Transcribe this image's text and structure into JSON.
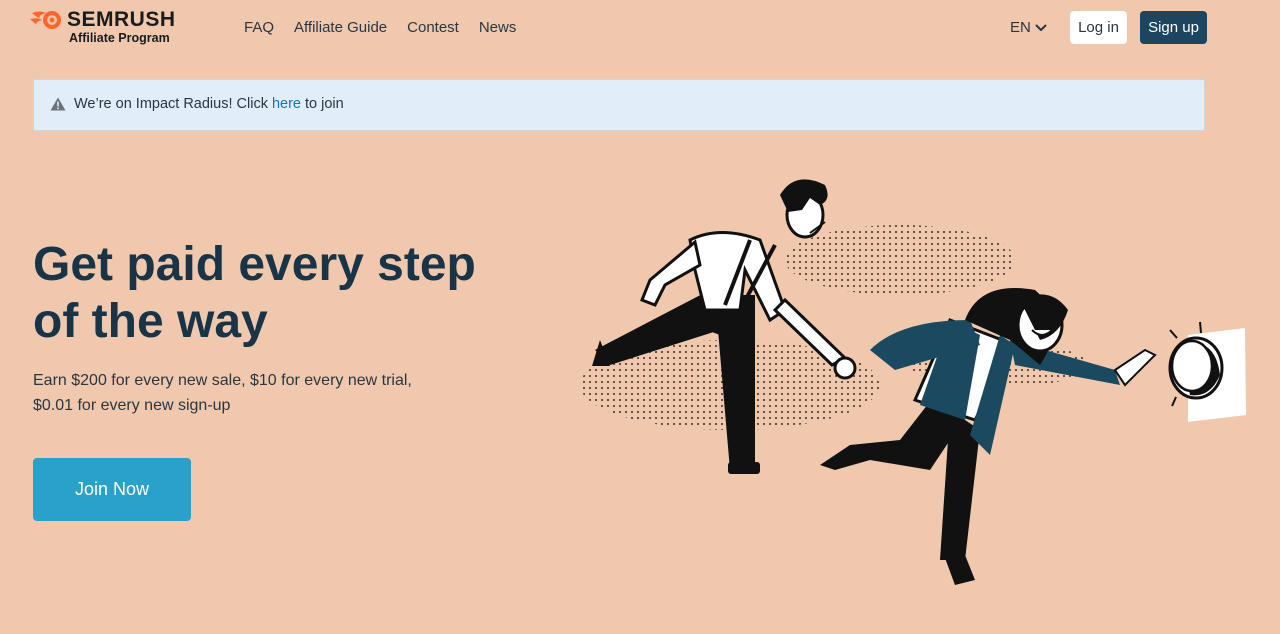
{
  "header": {
    "brand": "SEMRUSH",
    "brand_sub": "Affiliate Program",
    "nav": {
      "faq": "FAQ",
      "guide": "Affiliate Guide",
      "contest": "Contest",
      "news": "News"
    },
    "language": "EN",
    "login_label": "Log in",
    "signup_label": "Sign up"
  },
  "notice": {
    "text_before": "We’re on Impact Radius! Click ",
    "link": "here",
    "text_after": " to join"
  },
  "hero": {
    "title_line1": "Get paid every step",
    "title_line2": "of the way",
    "subtitle_line1": "Earn $200 for every new sale, $10 for every new trial,",
    "subtitle_line2": "$0.01 for every new sign-up",
    "cta": "Join Now"
  },
  "colors": {
    "background": "#efc8ae",
    "brand_orange": "#ff642d",
    "dark_navy": "#1c4560",
    "cta_blue": "#2aa1c9",
    "notice_bg": "#e1edf9",
    "link": "#1277b8"
  },
  "icons": {
    "logo": "semrush-fire-icon",
    "language_chevron": "chevron-down-icon",
    "notice": "warning-icon"
  }
}
